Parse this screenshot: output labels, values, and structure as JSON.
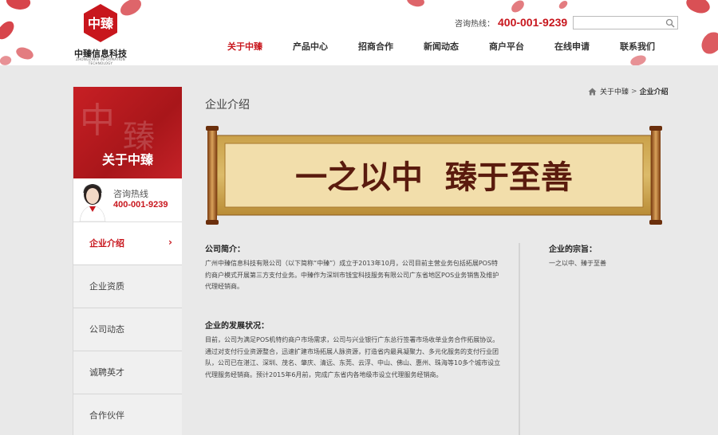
{
  "header": {
    "logo_mark": "中臻",
    "logo_name": "中臻信息科技",
    "logo_sub": "ZHONGZHEN INFORMATION TECHNOLOGY",
    "hotline_label": "咨询热线：",
    "hotline_number": "400-001-9239",
    "search_placeholder": ""
  },
  "nav": {
    "items": [
      {
        "label": "关于中臻"
      },
      {
        "label": "产品中心"
      },
      {
        "label": "招商合作"
      },
      {
        "label": "新闻动态"
      },
      {
        "label": "商户平台"
      },
      {
        "label": "在线申请"
      },
      {
        "label": "联系我们"
      }
    ]
  },
  "sidebar": {
    "banner_title": "关于中臻",
    "contact_label": "咨询热线",
    "contact_number": "400-001-9239",
    "items": [
      {
        "label": "企业介绍"
      },
      {
        "label": "企业资质"
      },
      {
        "label": "公司动态"
      },
      {
        "label": "诚聘英才"
      },
      {
        "label": "合作伙伴"
      }
    ],
    "arrow": "›"
  },
  "main": {
    "title": "企业介绍",
    "breadcrumb": {
      "parent": "关于中臻",
      "sep": ">",
      "current": "企业介绍"
    },
    "scroll_text": "一之以中  臻于至善",
    "intro": {
      "heading": "公司简介：",
      "body": "广州中臻信息科技有限公司（以下简称“中臻”）成立于2013年10月，公司目前主营业务包括拓展POS特约商户模式开展第三方支付业务。中臻作为深圳市钱宝科技服务有限公司广东省地区POS业务销售及维护代理经销商。"
    },
    "development": {
      "heading": "企业的发展状况：",
      "body": "目前，公司为满足POS机特约商户市场需求，公司与兴业银行广东总行签署市场收单业务合作拓展协议。通过对支付行业资源整合，迅速扩建市场拓展人脉资源，打造省内最具凝聚力、多元化服务的支付行业团队，公司已在湛江、深圳、茂名、肇庆、清远、东莞、云浮、中山、佛山、惠州、珠海等10多个城市设立代理服务经销商。预计2015年6月前，完成广东省内各地级市设立代理服务经销商。"
    },
    "aim": {
      "heading": "企业的宗旨：",
      "body": "一之以中、臻于至善"
    }
  },
  "colors": {
    "brand_red": "#c8161d",
    "page_bg": "#e9e9e9"
  }
}
